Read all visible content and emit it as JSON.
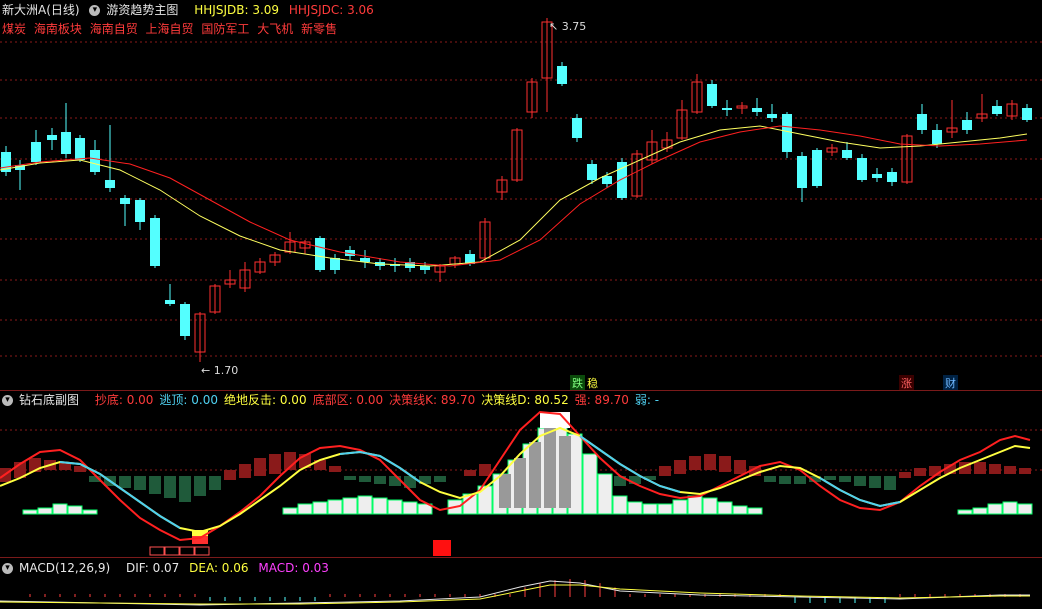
{
  "main": {
    "stock": "新大洲A(日线)",
    "indicator": "游资趋势主图",
    "hhjsjdb": "HHJSJDB: 3.09",
    "hhjsjdc": "HHJSJDC: 3.06",
    "sectors": [
      "煤炭",
      "海南板块",
      "海南自贸",
      "上海自贸",
      "国防军工",
      "大飞机",
      "新零售"
    ],
    "high_label": "3.75",
    "low_label": "1.70",
    "badges": {
      "die": "跌",
      "wen": "稳",
      "zhang": "涨",
      "cai": "财"
    }
  },
  "sub": {
    "name": "钻石底副图",
    "items": [
      {
        "text": "抄底: 0.00",
        "color": "#ff3b3b"
      },
      {
        "text": "逃顶: 0.00",
        "color": "#4fd0f0"
      },
      {
        "text": "绝地反击: 0.00",
        "color": "#ffff40"
      },
      {
        "text": "底部区: 0.00",
        "color": "#ff3b3b"
      },
      {
        "text": "决策线K: 89.70",
        "color": "#ff3b3b"
      },
      {
        "text": "决策线D: 80.52",
        "color": "#ffff40"
      },
      {
        "text": "强: 89.70",
        "color": "#ff3b3b"
      },
      {
        "text": "弱: -",
        "color": "#4fd0f0"
      }
    ]
  },
  "macd": {
    "name": "MACD(12,26,9)",
    "dif": "DIF: 0.07",
    "dea": "DEA: 0.06",
    "macd": "MACD: 0.03"
  },
  "colors": {
    "up": "#ff3030",
    "down": "#54ffff",
    "ma1": "#ffff60",
    "ma2": "#ff2020",
    "grid": "#8a1a1a"
  }
}
